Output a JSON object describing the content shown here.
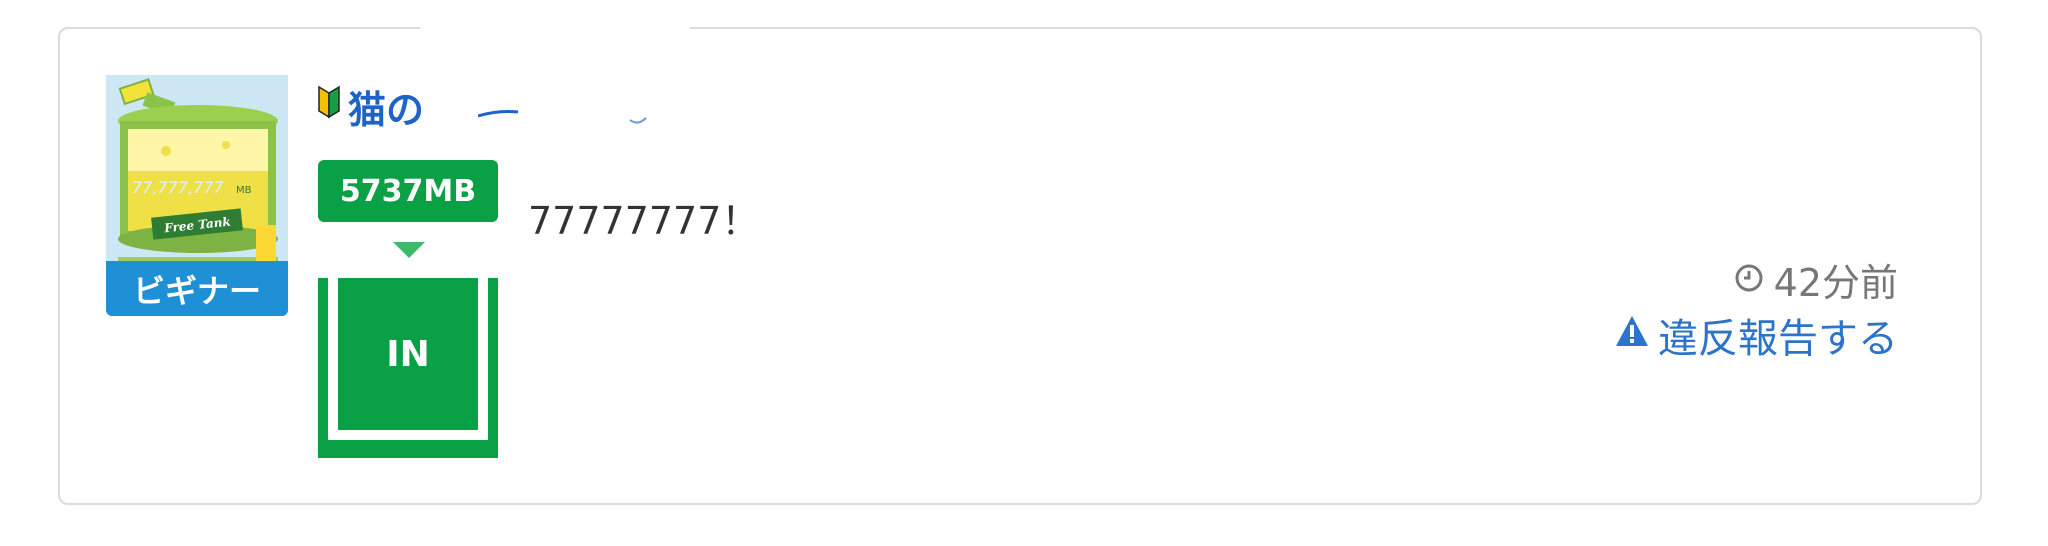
{
  "post": {
    "avatar": {
      "badge": "ビギナー",
      "image_text": "77,777,777",
      "image_unit": "MB",
      "image_caption": "Free Tank"
    },
    "user": {
      "name_visible": "猫の"
    },
    "tank": {
      "mb_label": "5737MB",
      "direction_label": "IN"
    },
    "message": "77777777！",
    "meta": {
      "time_ago": "42分前",
      "report_label": "違反報告する"
    },
    "colors": {
      "green": "#0aa045",
      "blue_badge": "#1f8fd6",
      "link_blue": "#2c74c9"
    },
    "icons": {
      "beginner": "beginner-mark-icon",
      "clock": "clock-icon",
      "warning": "warning-icon"
    }
  }
}
